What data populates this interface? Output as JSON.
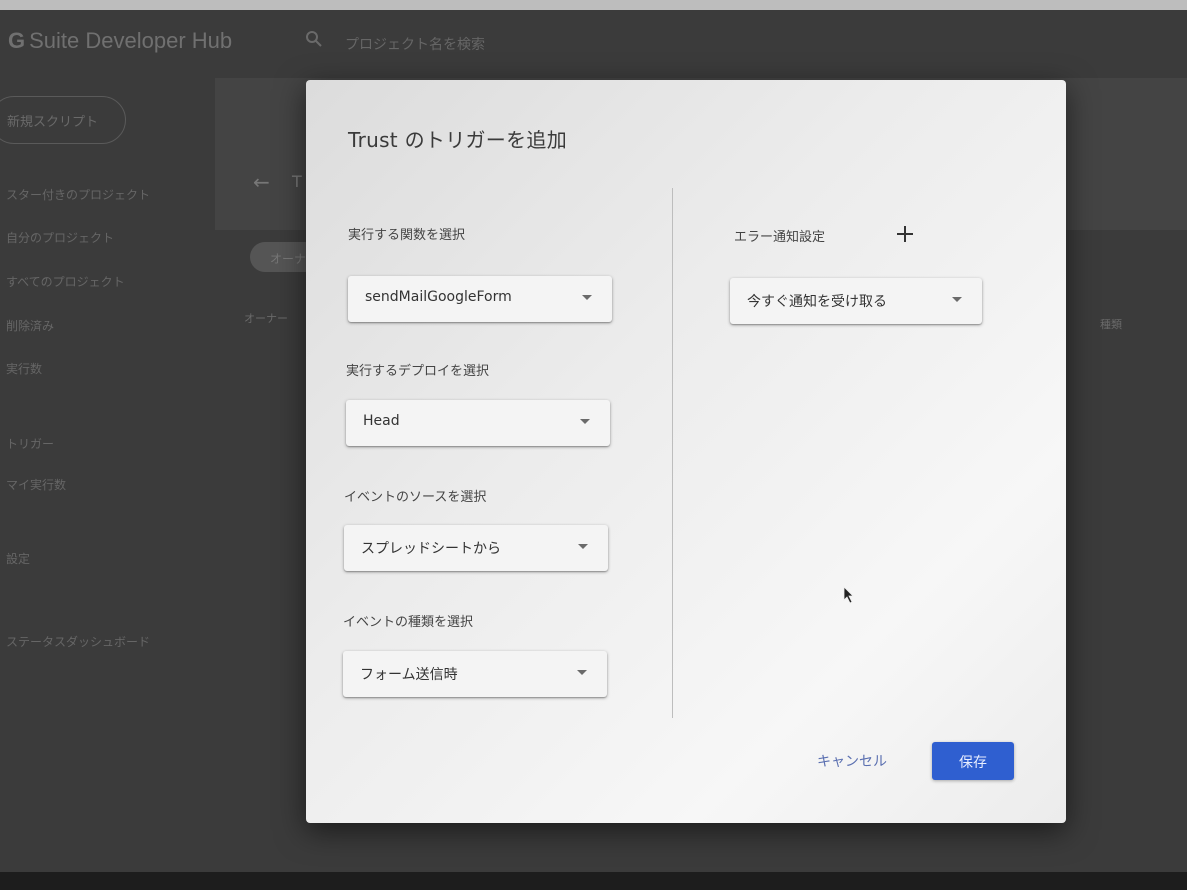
{
  "app": {
    "logo_letter": "G",
    "title": "Suite Developer Hub",
    "search_placeholder": "プロジェクト名を検索",
    "new_script_label": "新規スクリプト",
    "sidebar_items": [
      "スター付きのプロジェクト",
      "自分のプロジェクト",
      "すべてのプロジェクト",
      "削除済み",
      "実行数",
      "",
      "トリガー",
      "マイ実行数",
      "",
      "設定",
      "ステータスダッシュボード",
      "",
      "",
      ""
    ],
    "back_title": "T",
    "filter_chip": "オーナー",
    "col_owner": "オーナー",
    "col_type": "種類"
  },
  "dialog": {
    "title": "Trust のトリガーを追加",
    "function_label": "実行する関数を選択",
    "function_value": "sendMailGoogleForm",
    "deploy_label": "実行するデプロイを選択",
    "deploy_value": "Head",
    "source_label": "イベントのソースを選択",
    "source_value": "スプレッドシートから",
    "type_label": "イベントの種類を選択",
    "type_value": "フォーム送信時",
    "error_label": "エラー通知設定",
    "error_value": "今すぐ通知を受け取る",
    "cancel_label": "キャンセル",
    "save_label": "保存"
  },
  "colors": {
    "primary_button": "#2f5fd0",
    "cancel_text": "#5a6fb0"
  }
}
